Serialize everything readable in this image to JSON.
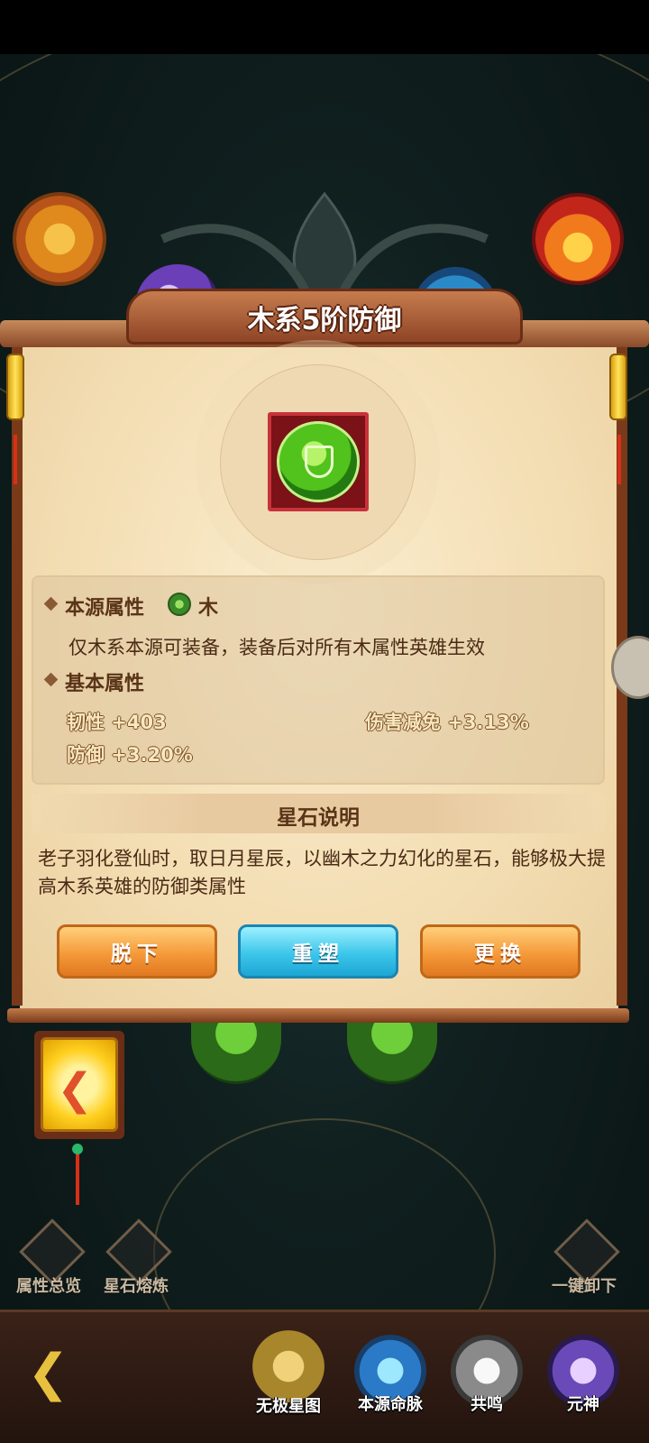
{
  "dialog": {
    "title": "木系5阶防御",
    "source_attr": {
      "heading": "本源属性",
      "element_icon": "wood-element-icon",
      "element": "木",
      "description": "仅木系本源可装备，装备后对所有木属性英雄生效"
    },
    "basic_attr": {
      "heading": "基本属性",
      "stats": [
        {
          "text": "韧性 +403"
        },
        {
          "text": "伤害减免 +3.13%"
        },
        {
          "text": "防御 +3.20%"
        }
      ]
    },
    "star_stone": {
      "heading": "星石说明",
      "description": "老子羽化登仙时，取日月星辰，以幽木之力幻化的星石，能够极大提高木系英雄的防御类属性"
    },
    "buttons": {
      "remove": "脱下",
      "reshape": "重塑",
      "replace": "更换"
    }
  },
  "tools": {
    "overview": "属性总览",
    "smelt": "星石熔炼",
    "unequip_all": "一键卸下"
  },
  "nav": {
    "tabs": [
      "无极星图",
      "本源命脉",
      "共鸣",
      "元神"
    ]
  },
  "colors": {
    "orange_button": "#f59a3a",
    "blue_button": "#3cc6ea",
    "gem_green": "#52c21c",
    "slot_red": "#7a1218"
  }
}
